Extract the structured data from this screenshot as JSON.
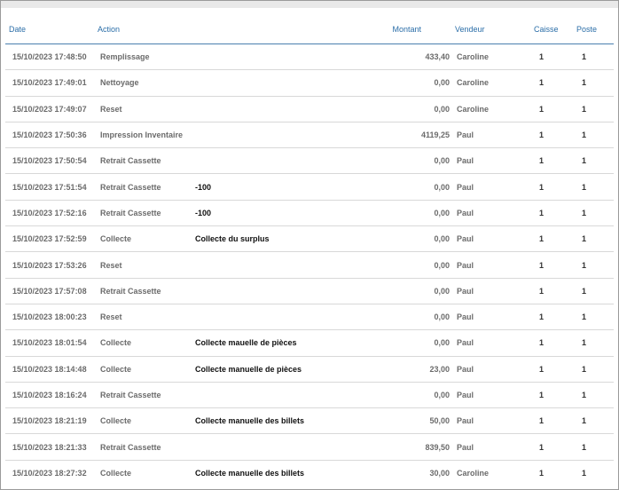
{
  "columns": {
    "date": "Date",
    "action": "Action",
    "amount": "Montant",
    "seller": "Vendeur",
    "caisse": "Caisse",
    "poste": "Poste"
  },
  "rows": [
    {
      "date": "15/10/2023 17:48:50",
      "action": "Remplissage",
      "detail": "",
      "amount": "433,40",
      "seller": "Caroline",
      "caisse": "1",
      "poste": "1"
    },
    {
      "date": "15/10/2023 17:49:01",
      "action": "Nettoyage",
      "detail": "",
      "amount": "0,00",
      "seller": "Caroline",
      "caisse": "1",
      "poste": "1"
    },
    {
      "date": "15/10/2023 17:49:07",
      "action": "Reset",
      "detail": "",
      "amount": "0,00",
      "seller": "Caroline",
      "caisse": "1",
      "poste": "1"
    },
    {
      "date": "15/10/2023 17:50:36",
      "action": "Impression Inventaire",
      "detail": "",
      "amount": "4119,25",
      "seller": "Paul",
      "caisse": "1",
      "poste": "1"
    },
    {
      "date": "15/10/2023 17:50:54",
      "action": "Retrait Cassette",
      "detail": "",
      "amount": "0,00",
      "seller": "Paul",
      "caisse": "1",
      "poste": "1"
    },
    {
      "date": "15/10/2023 17:51:54",
      "action": "Retrait Cassette",
      "detail": "-100",
      "amount": "0,00",
      "seller": "Paul",
      "caisse": "1",
      "poste": "1"
    },
    {
      "date": "15/10/2023 17:52:16",
      "action": "Retrait Cassette",
      "detail": "-100",
      "amount": "0,00",
      "seller": "Paul",
      "caisse": "1",
      "poste": "1"
    },
    {
      "date": "15/10/2023 17:52:59",
      "action": "Collecte",
      "detail": "Collecte du surplus",
      "amount": "0,00",
      "seller": "Paul",
      "caisse": "1",
      "poste": "1"
    },
    {
      "date": "15/10/2023 17:53:26",
      "action": "Reset",
      "detail": "",
      "amount": "0,00",
      "seller": "Paul",
      "caisse": "1",
      "poste": "1"
    },
    {
      "date": "15/10/2023 17:57:08",
      "action": "Retrait Cassette",
      "detail": "",
      "amount": "0,00",
      "seller": "Paul",
      "caisse": "1",
      "poste": "1"
    },
    {
      "date": "15/10/2023 18:00:23",
      "action": "Reset",
      "detail": "",
      "amount": "0,00",
      "seller": "Paul",
      "caisse": "1",
      "poste": "1"
    },
    {
      "date": "15/10/2023 18:01:54",
      "action": "Collecte",
      "detail": "Collecte mauelle de pièces",
      "amount": "0,00",
      "seller": "Paul",
      "caisse": "1",
      "poste": "1"
    },
    {
      "date": "15/10/2023 18:14:48",
      "action": "Collecte",
      "detail": "Collecte manuelle de pièces",
      "amount": "23,00",
      "seller": "Paul",
      "caisse": "1",
      "poste": "1"
    },
    {
      "date": "15/10/2023 18:16:24",
      "action": "Retrait Cassette",
      "detail": "",
      "amount": "0,00",
      "seller": "Paul",
      "caisse": "1",
      "poste": "1"
    },
    {
      "date": "15/10/2023 18:21:19",
      "action": "Collecte",
      "detail": "Collecte manuelle des billets",
      "amount": "50,00",
      "seller": "Paul",
      "caisse": "1",
      "poste": "1"
    },
    {
      "date": "15/10/2023 18:21:33",
      "action": "Retrait Cassette",
      "detail": "",
      "amount": "839,50",
      "seller": "Paul",
      "caisse": "1",
      "poste": "1"
    },
    {
      "date": "15/10/2023 18:27:32",
      "action": "Collecte",
      "detail": "Collecte manuelle des billets",
      "amount": "30,00",
      "seller": "Caroline",
      "caisse": "1",
      "poste": "1"
    }
  ],
  "colors": {
    "header_text": "#2b6ea8",
    "header_rule": "#4a7fae",
    "row_text": "#6b6b6b",
    "detail_text": "#111111",
    "row_divider": "#d8d8d8"
  }
}
